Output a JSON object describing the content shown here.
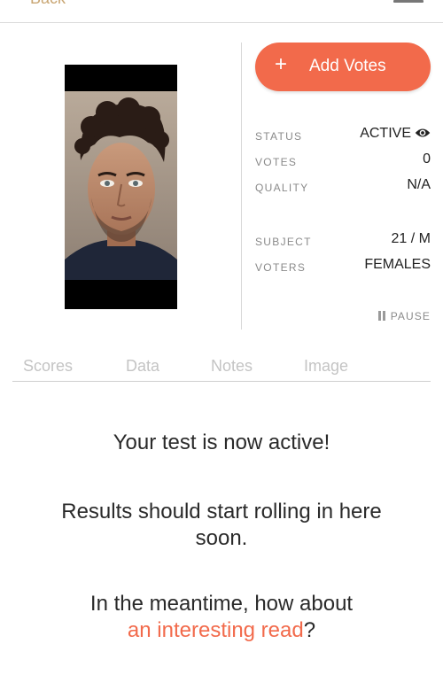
{
  "header": {
    "back_label": "Back"
  },
  "actions": {
    "add_votes_label": "Add Votes",
    "add_votes_icon": "plus-icon",
    "pause_label": "PAUSE"
  },
  "stats": [
    {
      "key": "STATUS",
      "value": "ACTIVE",
      "icon": "eye-icon"
    },
    {
      "key": "VOTES",
      "value": "0"
    },
    {
      "key": "QUALITY",
      "value": "N/A"
    },
    {
      "key": "SUBJECT",
      "value": "21 / M"
    },
    {
      "key": "VOTERS",
      "value": "FEMALES"
    }
  ],
  "tabs": [
    "Scores",
    "Data",
    "Notes",
    "Image"
  ],
  "message": {
    "line1": "Your test is now active!",
    "line2": "Results should start rolling in here soon.",
    "line3_prefix": "In the meantime, how about",
    "line3_link": "an interesting read",
    "line3_suffix": "?"
  },
  "colors": {
    "accent": "#f26a4b",
    "back_link": "#c9a673"
  }
}
